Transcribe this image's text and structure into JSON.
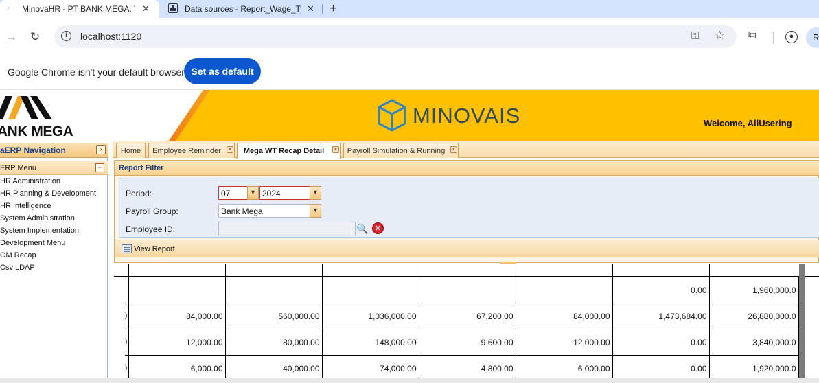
{
  "browser": {
    "tabs": [
      {
        "title": "MinovaHR - PT BANK MEGA. Tb",
        "active": true
      },
      {
        "title": "Data sources - Report_Wage_Ty",
        "active": false
      }
    ],
    "new_tab_glyph": "+",
    "close_glyph": "✕",
    "url": "localhost:1120",
    "profile_initial": "R",
    "infobar": {
      "message": "Google Chrome isn't your default browser",
      "button": "Set as default"
    }
  },
  "app": {
    "bank_logo_text": "ANK MEGA",
    "product_logo_text": "MINOVAIS",
    "welcome": "Welcome, AllUsering",
    "brand_colors": {
      "banner": "#ffc000",
      "stripe": "#f07b17",
      "nav_title": "#15428b"
    }
  },
  "navigation": {
    "title": "aERP Navigation",
    "collapse_glyph": "«",
    "menu_title": "ERP Menu",
    "menu_collapse_glyph": "−",
    "items": [
      "HR Administration",
      "HR Planning & Development",
      "HR Intelligence",
      "System Administration",
      "System Implementation",
      "Development Menu",
      "OM Recap",
      "Csv LDAP"
    ]
  },
  "content_tabs": [
    {
      "label": "Home",
      "closable": false,
      "active": false
    },
    {
      "label": "Employee Reminder",
      "closable": true,
      "active": false
    },
    {
      "label": "Mega WT Recap Detail",
      "closable": true,
      "active": true
    },
    {
      "label": "Payroll Simulation & Running",
      "closable": true,
      "active": false
    }
  ],
  "report_filter": {
    "title": "Report Filter",
    "period_label": "Period:",
    "period_month": "07",
    "period_year": "2024",
    "payroll_group_label": "Payroll Group:",
    "payroll_group_value": "Bank Mega",
    "employee_id_label": "Employee ID:",
    "employee_id_value": "",
    "view_report": "View Report",
    "dropdown_glyph": "▼",
    "search_glyph": "🔍",
    "clear_glyph": "✕"
  },
  "report": {
    "rows": [
      {
        "edge": "",
        "cells": [
          "",
          "",
          "",
          "",
          "",
          "0.00",
          "1,960,000.0"
        ]
      },
      {
        "edge": ")",
        "cells": [
          "84,000.00",
          "560,000.00",
          "1,036,000.00",
          "67,200.00",
          "84,000.00",
          "1,473,684.00",
          "26,880,000.0"
        ]
      },
      {
        "edge": ")",
        "cells": [
          "12,000.00",
          "80,000.00",
          "148,000.00",
          "9,600.00",
          "12,000.00",
          "0.00",
          "3,840,000.0"
        ]
      },
      {
        "edge": ")",
        "cells": [
          "6,000.00",
          "40,000.00",
          "74,000.00",
          "4,800.00",
          "6,000.00",
          "0.00",
          "1,920,000.0"
        ]
      }
    ]
  }
}
